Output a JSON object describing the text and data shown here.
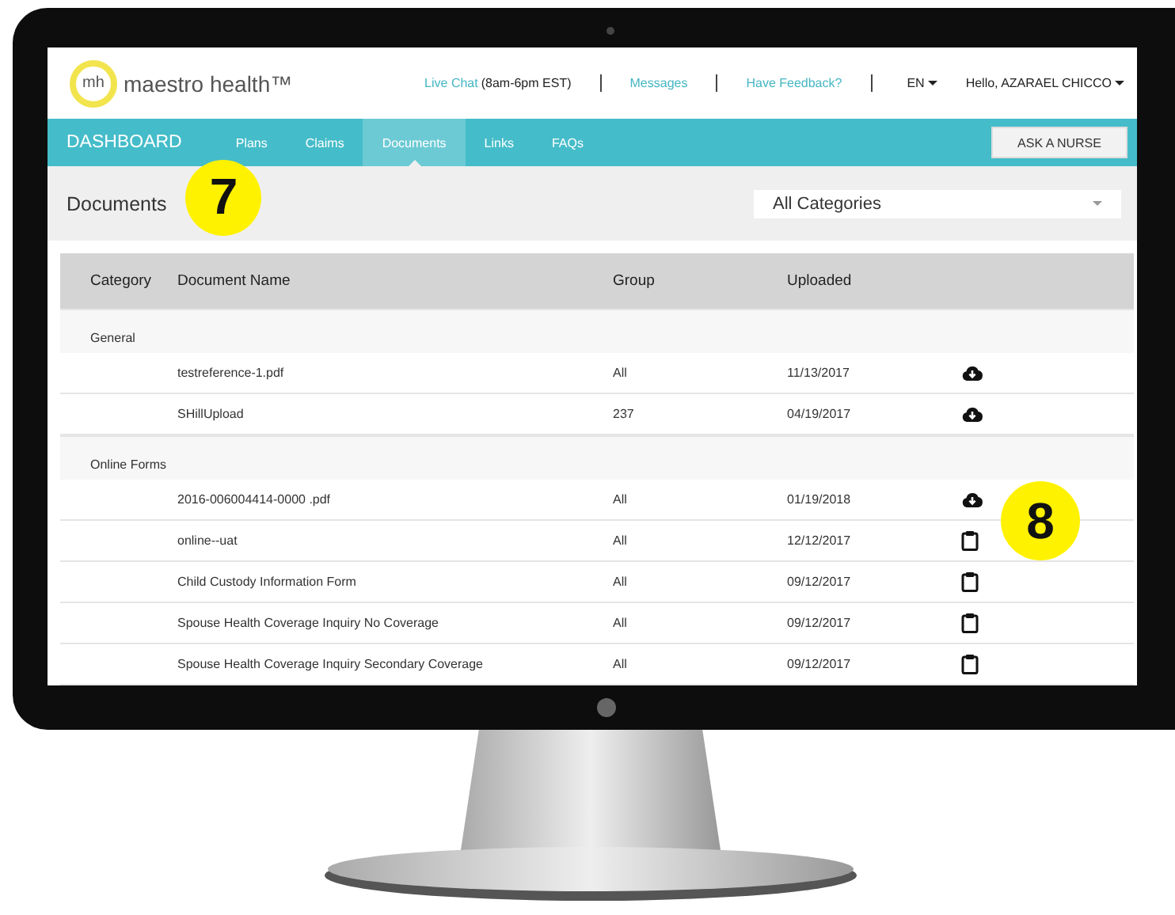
{
  "header": {
    "logo_mark": "mh",
    "brand": "maestro health™",
    "live_chat": "Live Chat",
    "hours": "(8am-6pm EST)",
    "messages": "Messages",
    "feedback": "Have Feedback?",
    "language": "EN",
    "user": "Hello, AZARAEL CHICCO"
  },
  "nav": {
    "items": [
      {
        "label": "DASHBOARD",
        "kind": "home",
        "selected": false
      },
      {
        "label": "Plans",
        "kind": "link",
        "selected": false
      },
      {
        "label": "Claims",
        "kind": "link",
        "selected": false
      },
      {
        "label": "Documents",
        "kind": "link",
        "selected": true
      },
      {
        "label": "Links",
        "kind": "link",
        "selected": false
      },
      {
        "label": "FAQs",
        "kind": "link",
        "selected": false
      }
    ],
    "button": "ASK A NURSE"
  },
  "page": {
    "title": "Documents",
    "filter": "All Categories"
  },
  "table": {
    "columns": [
      "Category",
      "Document Name",
      "Group",
      "Uploaded"
    ],
    "rows": [
      {
        "kind": "group",
        "category": "General"
      },
      {
        "kind": "download",
        "name": "testreference-1.pdf",
        "group": "All",
        "uploaded": "11/13/2017"
      },
      {
        "kind": "download",
        "name": "SHillUpload",
        "group": "237",
        "uploaded": "04/19/2017"
      },
      {
        "kind": "group",
        "category": "Online Forms"
      },
      {
        "kind": "download",
        "name": "2016-006004414-0000 .pdf",
        "group": "All",
        "uploaded": "01/19/2018"
      },
      {
        "kind": "form",
        "name": "online--uat",
        "group": "All",
        "uploaded": "12/12/2017"
      },
      {
        "kind": "form",
        "name": "Child Custody Information Form",
        "group": "All",
        "uploaded": "09/12/2017"
      },
      {
        "kind": "form",
        "name": "Spouse Health Coverage Inquiry No Coverage",
        "group": "All",
        "uploaded": "09/12/2017"
      },
      {
        "kind": "form",
        "name": "Spouse Health Coverage Inquiry Secondary Coverage",
        "group": "All",
        "uploaded": "09/12/2017"
      }
    ]
  },
  "annotations": [
    {
      "label": "7"
    },
    {
      "label": "8"
    }
  ]
}
